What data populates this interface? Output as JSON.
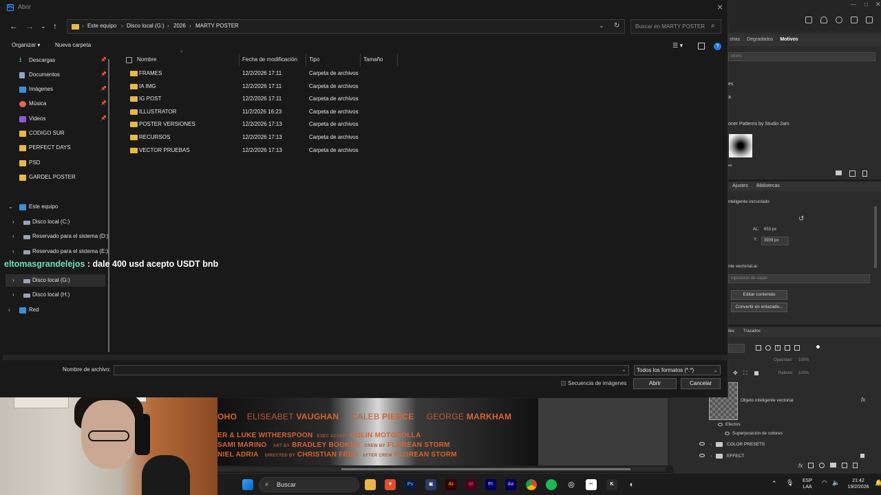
{
  "dialog": {
    "title": "Abrir",
    "address": [
      "Este equipo",
      "Disco local (G:)",
      "2026",
      "MARTY POSTER"
    ],
    "search_placeholder": "Buscar en MARTY POSTER",
    "organize_label": "Organizar",
    "new_folder_label": "Nueva carpeta",
    "filename_label": "Nombre de archivo:",
    "filename_value": "",
    "filter_value": "Todos los formatos (*.*)",
    "sequence_label": "Secuencia de imágenes",
    "open_label": "Abrir",
    "cancel_label": "Cancelar"
  },
  "sidebar": {
    "quick": [
      {
        "label": "Descargas",
        "icon": "download-icon",
        "pinned": true
      },
      {
        "label": "Documentos",
        "icon": "document-icon",
        "pinned": true
      },
      {
        "label": "Imágenes",
        "icon": "image-icon",
        "pinned": true
      },
      {
        "label": "Música",
        "icon": "music-icon",
        "pinned": true
      },
      {
        "label": "Videos",
        "icon": "video-icon",
        "pinned": true
      },
      {
        "label": "CODIGO SUR",
        "icon": "folder-icon",
        "pinned": false
      },
      {
        "label": "PERFECT DAYS",
        "icon": "folder-icon",
        "pinned": false
      },
      {
        "label": "PSD",
        "icon": "folder-icon",
        "pinned": false
      },
      {
        "label": "GARDEL POSTER",
        "icon": "folder-icon",
        "pinned": false
      }
    ],
    "this_pc": "Este equipo",
    "drives": [
      "Disco local (C:)",
      "Reservado para el sistema (D:)",
      "Reservado para el sistema (E:)",
      "Disco local (G:)",
      "Disco local  (H:)"
    ],
    "network": "Red"
  },
  "columns": {
    "name": "Nombre",
    "date": "Fecha de modificación",
    "type": "Tipo",
    "size": "Tamaño"
  },
  "files": [
    {
      "name": "FRAMES",
      "date": "12/2/2026 17:11",
      "type": "Carpeta de archivos"
    },
    {
      "name": "IA IMG",
      "date": "12/2/2026 17:11",
      "type": "Carpeta de archivos"
    },
    {
      "name": "IG POST",
      "date": "12/2/2026 17:11",
      "type": "Carpeta de archivos"
    },
    {
      "name": "ILLUSTRATOR",
      "date": "11/2/2026 16:23",
      "type": "Carpeta de archivos"
    },
    {
      "name": "POSTER VERSIONES",
      "date": "12/2/2026 17:13",
      "type": "Carpeta de archivos"
    },
    {
      "name": "RECURSOS",
      "date": "12/2/2026 17:13",
      "type": "Carpeta de archivos"
    },
    {
      "name": "VECTOR PRUEBAS",
      "date": "12/2/2026 17:13",
      "type": "Carpeta de archivos"
    }
  ],
  "chat": {
    "user": "eltomasgrandelejos",
    "message": " : dale 400 usd acepto USDT bnb"
  },
  "photoshop": {
    "tabs": [
      "stras",
      "Degradados",
      "Motivos"
    ],
    "search_placeholder": "otivos",
    "pattern_group_1": "es",
    "pattern_group_2": "a",
    "pattern_title": "oner Patterns by Studio 2am",
    "pattern_group_3": "es",
    "props_tabs": [
      "Ajustes",
      "Bibliotecas"
    ],
    "smart_object": "nteligente incrustado",
    "al_label": "AL:",
    "al_value": "653 px",
    "y_label": "Y:",
    "y_value": "3939 px",
    "file_name": "nte vectorial.ai",
    "layer_comp": "mposición de capas",
    "edit_content": "Editar contenido",
    "convert_linked": "Convertir en enlazado...",
    "layers_tabs": [
      "iles",
      "Trazados"
    ],
    "opacity_label": "Opacidad:",
    "opacity_value": "100%",
    "fill_label": "Relleno:",
    "fill_value": "100%",
    "layer_name": "Objeto inteligente vectorial",
    "effects_label": "Efectos",
    "color_overlay": "Superposición de colores",
    "group_1": "COLOR PRESETS",
    "group_2": "EFFECT"
  },
  "poster": {
    "line1": [
      "OHO",
      "ELISEABET",
      "VAUGHAN",
      "CALEB",
      "PIERCE",
      "GEORGE",
      "MARKHAM"
    ],
    "line2": [
      "ER & LUKE WITHERSPOON",
      "EXEC ACTOR",
      "COLIN MOTOROLLA"
    ],
    "line3": [
      "SAMI MARINO",
      "ART BY",
      "BRADLEY BOOKER",
      "CREW BY",
      "FLOREAN STORM"
    ],
    "line4": [
      "NIEL ADRIA",
      "DIRECTED BY",
      "CHRISTIAN FRED",
      "AFTER CREW",
      "FLOREAN STORM"
    ]
  },
  "taskbar": {
    "search_label": "Buscar",
    "lang_1": "ESP",
    "lang_2": "LAA",
    "time": "21:42",
    "date": "19/2/2026"
  }
}
